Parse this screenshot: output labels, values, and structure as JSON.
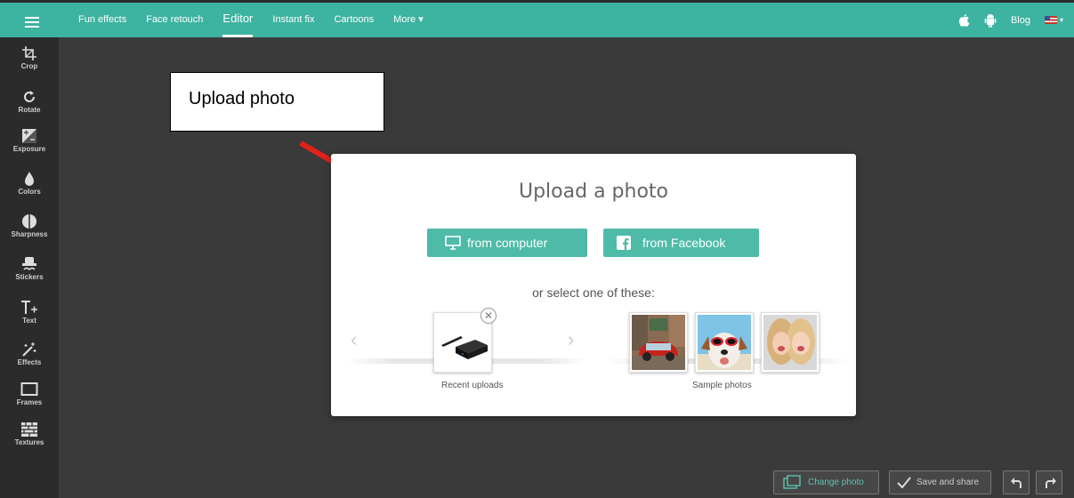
{
  "nav": {
    "items": [
      "Fun effects",
      "Face retouch",
      "Editor",
      "Instant fix",
      "Cartoons",
      "More ▾"
    ],
    "active": "Editor",
    "blog": "Blog"
  },
  "sidebar": {
    "items": [
      {
        "label": "Crop",
        "icon": "crop-icon"
      },
      {
        "label": "Rotate",
        "icon": "rotate-icon"
      },
      {
        "label": "Exposure",
        "icon": "exposure-icon"
      },
      {
        "label": "Colors",
        "icon": "colors-icon"
      },
      {
        "label": "Sharpness",
        "icon": "sharpness-icon"
      },
      {
        "label": "Stickers",
        "icon": "stickers-icon"
      },
      {
        "label": "Text",
        "icon": "text-icon"
      },
      {
        "label": "Effects",
        "icon": "effects-icon"
      },
      {
        "label": "Frames",
        "icon": "frames-icon"
      },
      {
        "label": "Textures",
        "icon": "textures-icon"
      }
    ]
  },
  "callout": {
    "text": "Upload photo"
  },
  "modal": {
    "title": "Upload a photo",
    "from_computer": "from computer",
    "from_facebook": "from Facebook",
    "or_select": "or select one of these:",
    "recent_uploads": "Recent uploads",
    "sample_photos": "Sample photos"
  },
  "bottom": {
    "change_photo": "Change photo",
    "save_and_share": "Save and share"
  },
  "colors": {
    "accent": "#3db3a1",
    "button": "#4dbba7",
    "canvas": "#3a3a3a",
    "sidebar": "#2b2b2b"
  }
}
